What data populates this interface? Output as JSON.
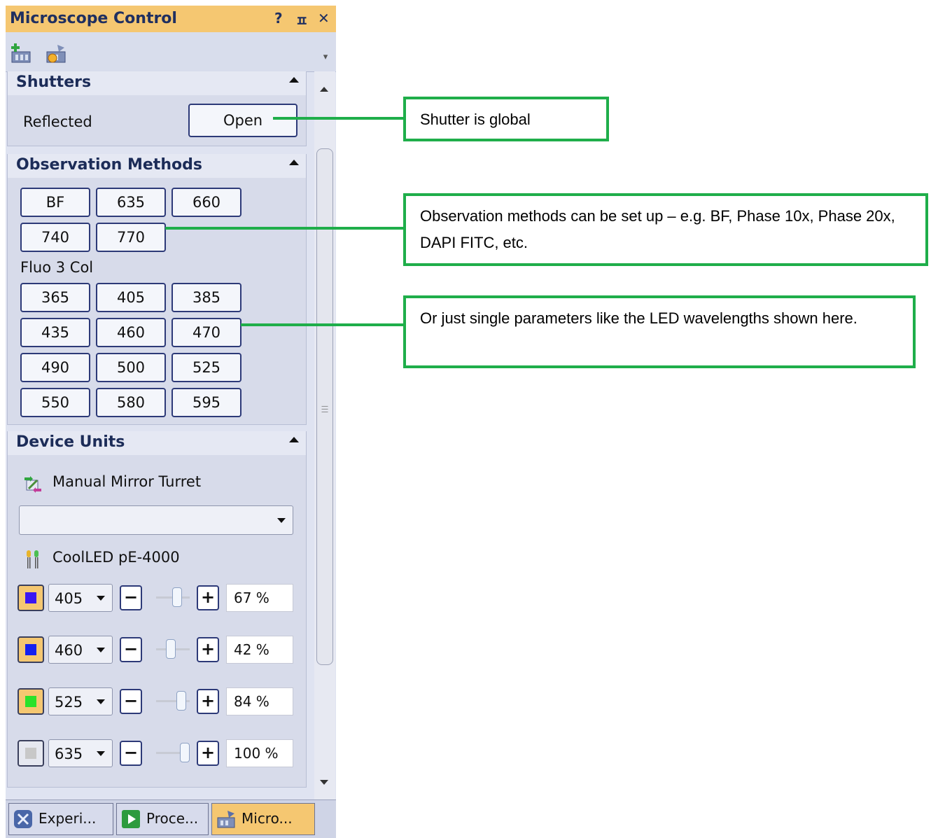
{
  "panel": {
    "title": "Microscope Control",
    "help_label": "?",
    "pin_label": "ㅍ",
    "close_label": "✕",
    "toolbar_icons": [
      "add-configuration-icon",
      "settings-configuration-icon"
    ]
  },
  "shutters": {
    "title": "Shutters",
    "label": "Reflected",
    "button": "Open"
  },
  "observation": {
    "title": "Observation Methods",
    "row1": [
      "BF",
      "635",
      "660"
    ],
    "row2": [
      "740",
      "770"
    ],
    "group_label": "Fluo 3 Col",
    "row3": [
      "365",
      "405",
      "385"
    ],
    "row4": [
      "435",
      "460",
      "470"
    ],
    "row5": [
      "490",
      "500",
      "525"
    ],
    "row6": [
      "550",
      "580",
      "595"
    ]
  },
  "device_units": {
    "title": "Device Units",
    "turret_label": "Manual Mirror Turret",
    "turret_value": "",
    "led_label": "CoolLED pE-4000",
    "leds": [
      {
        "wavelength": "405",
        "percent": "67 %",
        "level": 0.67,
        "color": "#3a16f2",
        "active": true
      },
      {
        "wavelength": "460",
        "percent": "42 %",
        "level": 0.42,
        "color": "#1520f0",
        "active": true
      },
      {
        "wavelength": "525",
        "percent": "84 %",
        "level": 0.84,
        "color": "#2ae22a",
        "active": true
      },
      {
        "wavelength": "635",
        "percent": "100 %",
        "level": 1.0,
        "color": "#c8c8c8",
        "active": false
      }
    ]
  },
  "tabs": [
    "Experi...",
    "Proce...",
    "Micro..."
  ],
  "callouts": {
    "shutter": "Shutter is global",
    "methods": "Observation methods can be set up – e.g. BF, Phase 10x, Phase 20x, DAPI FITC, etc.",
    "single": "Or just single parameters like the LED wavelengths shown here."
  },
  "colors": {
    "title_bar": "#f5c771",
    "panel_bg": "#dfe3f1",
    "callout_border": "#1fae4a",
    "button_border": "#2d3a78"
  }
}
